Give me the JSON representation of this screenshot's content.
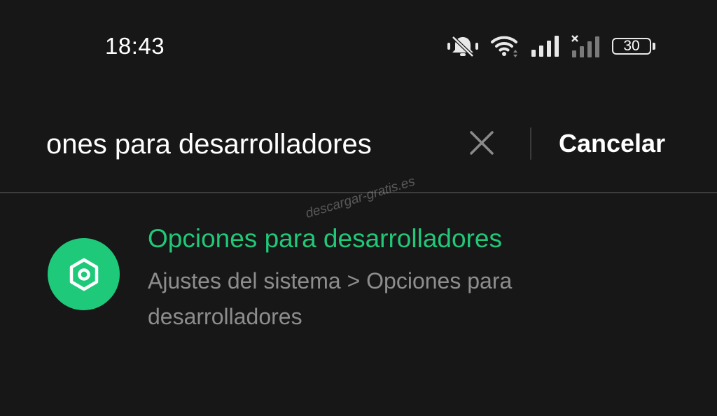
{
  "status_bar": {
    "time": "18:43",
    "icons": [
      "bell-muted-icon",
      "wifi-icon",
      "signal-icon",
      "signal-no-service-icon",
      "battery-icon"
    ],
    "battery_level": "30"
  },
  "search": {
    "query": "ones para desarrolladores",
    "clear_icon": "close-icon",
    "cancel_label": "Cancelar"
  },
  "results": [
    {
      "icon": "hexagon-gear-icon",
      "title": "Opciones para desarrolladores",
      "path": "Ajustes del sistema > Opciones para desarrolladores"
    }
  ],
  "watermark": "descargar-gratis.es",
  "colors": {
    "background": "#171717",
    "accent": "#20c878",
    "icon_bg": "#1ec97a",
    "secondary_text": "#8d8d8d"
  }
}
